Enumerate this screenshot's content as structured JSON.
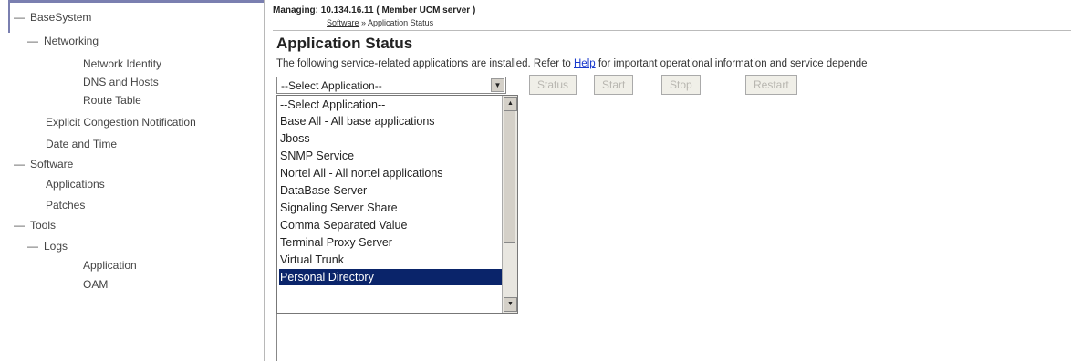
{
  "sidebar": {
    "basesystem": "BaseSystem",
    "networking": "Networking",
    "network_identity": "Network Identity",
    "dns_hosts": "DNS and Hosts",
    "route_table": "Route Table",
    "ecn": "Explicit Congestion Notification",
    "date_time": "Date and Time",
    "software": "Software",
    "applications": "Applications",
    "patches": "Patches",
    "tools": "Tools",
    "logs": "Logs",
    "application": "Application",
    "oam": "OAM"
  },
  "header": {
    "managing": "Managing: 10.134.16.11 ( Member UCM server )",
    "crumb_software": "Software",
    "crumb_sep": " » ",
    "crumb_current": "Application Status"
  },
  "page": {
    "title": "Application Status",
    "desc_prefix": "The following service-related applications are installed. Refer to ",
    "desc_link": "Help",
    "desc_suffix": " for important operational information and service depende"
  },
  "select": {
    "value": "--Select Application--",
    "options": [
      "--Select Application--",
      "Base All - All base applications",
      "Jboss",
      "SNMP Service",
      "Nortel All - All nortel applications",
      "DataBase Server",
      "Signaling Server Share",
      "Comma Separated Value",
      "Terminal Proxy Server",
      "Virtual Trunk",
      "Personal Directory"
    ]
  },
  "buttons": {
    "status": "Status",
    "start": "Start",
    "stop": "Stop",
    "restart": "Restart"
  },
  "colors": {
    "selected_bg": "#0a246a",
    "link": "#1a3acc"
  }
}
